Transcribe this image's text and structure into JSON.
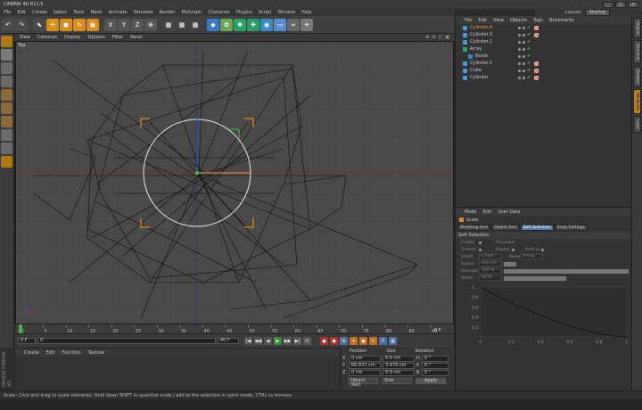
{
  "window": {
    "title": "CINEMA 4D R11.5",
    "min": "_",
    "max": "□",
    "close": "×"
  },
  "menubar": [
    "File",
    "Edit",
    "Create",
    "Select",
    "Tools",
    "Mesh",
    "Animate",
    "Simulate",
    "Render",
    "MoGraph",
    "Character",
    "Plugins",
    "Script",
    "Window",
    "Help"
  ],
  "layout": {
    "label": "Layout:",
    "value": "Startup"
  },
  "toolbar": {
    "items": [
      {
        "name": "undo-icon",
        "glyph": "↶",
        "color": "#4a4a4a"
      },
      {
        "name": "redo-icon",
        "glyph": "↷",
        "color": "#4a4a4a"
      },
      {
        "name": "sep"
      },
      {
        "name": "live-select-icon",
        "glyph": "⬉",
        "color": "#4a4a4a"
      },
      {
        "name": "move-icon",
        "glyph": "✛",
        "color": "#d98c1a"
      },
      {
        "name": "scale-icon",
        "glyph": "◼",
        "color": "#d98c1a"
      },
      {
        "name": "rotate-icon",
        "glyph": "↻",
        "color": "#d98c1a"
      },
      {
        "name": "recent-tool-icon",
        "glyph": "▣",
        "color": "#d98c1a"
      },
      {
        "name": "sep"
      },
      {
        "name": "x-axis-icon",
        "glyph": "X",
        "color": "#555"
      },
      {
        "name": "y-axis-icon",
        "glyph": "Y",
        "color": "#555"
      },
      {
        "name": "z-axis-icon",
        "glyph": "Z",
        "color": "#555"
      },
      {
        "name": "coord-system-icon",
        "glyph": "⊕",
        "color": "#555"
      },
      {
        "name": "sep"
      },
      {
        "name": "render-view-icon",
        "glyph": "▦",
        "color": "#444"
      },
      {
        "name": "render-picture-viewer-icon",
        "glyph": "▦",
        "color": "#444"
      },
      {
        "name": "render-settings-icon",
        "glyph": "▦",
        "color": "#444"
      },
      {
        "name": "sep"
      },
      {
        "name": "cube-icon",
        "glyph": "◆",
        "color": "#3a7ac4"
      },
      {
        "name": "subdivision-icon",
        "glyph": "✿",
        "color": "#6aa84f"
      },
      {
        "name": "array-icon",
        "glyph": "✺",
        "color": "#2ea06a"
      },
      {
        "name": "spline-icon",
        "glyph": "✚",
        "color": "#2a9a6a"
      },
      {
        "name": "deformer-icon",
        "glyph": "◉",
        "color": "#3c8ac6"
      },
      {
        "name": "scene-icon",
        "glyph": "▭",
        "color": "#5a8ad0"
      },
      {
        "name": "camera-icon",
        "glyph": "∞",
        "color": "#666"
      },
      {
        "name": "light-icon",
        "glyph": "☀",
        "color": "#777"
      }
    ]
  },
  "left_tools": [
    {
      "name": "make-editable-icon",
      "color": "#b07a10"
    },
    {
      "name": "model-mode-icon",
      "color": "#7a7a7a"
    },
    {
      "name": "texture-mode-icon",
      "color": "#6a6a6a"
    },
    {
      "name": "workplane-icon",
      "color": "#6a6a6a"
    },
    {
      "name": "points-mode-icon",
      "color": "#8a6a3a"
    },
    {
      "name": "edges-mode-icon",
      "color": "#8a6a3a"
    },
    {
      "name": "polygons-mode-icon",
      "color": "#8a6a3a"
    },
    {
      "name": "axis-mode-icon",
      "color": "#6a6a6a"
    },
    {
      "name": "tweak-mode-icon",
      "color": "#6a6a6a"
    },
    {
      "name": "snap-icon",
      "color": "#b07a10"
    }
  ],
  "viewport": {
    "menu": [
      "View",
      "Cameras",
      "Display",
      "Options",
      "Filter",
      "Panel"
    ],
    "label": "Top",
    "icons": [
      "✥",
      "⊕",
      "◱",
      "▣"
    ]
  },
  "timeline": {
    "ticks": [
      "0",
      "5",
      "10",
      "15",
      "20",
      "25",
      "30",
      "35",
      "40",
      "45",
      "50",
      "55",
      "60",
      "65",
      "70",
      "75",
      "80",
      "85",
      "90"
    ],
    "end_frame": "0 F",
    "start_field": "0 F",
    "current_field": "0",
    "end_field": "90 F",
    "play_buttons": [
      "|◀",
      "◀◀",
      "◀",
      "▶",
      "▶▶",
      "▶|",
      "⟳"
    ]
  },
  "material": {
    "menu": [
      "Create",
      "Edit",
      "Function",
      "Texture"
    ],
    "brand": "MAXON CINEMA 4D"
  },
  "coords": {
    "headers": [
      "Position",
      "Size",
      "Rotation"
    ],
    "rows": [
      {
        "axis": "X",
        "pos": "0 cm",
        "size": "6.6 cm",
        "rot_label": "H",
        "rot": "0 °"
      },
      {
        "axis": "Y",
        "pos": "66.831 cm",
        "size": "3.479 cm",
        "rot_label": "P",
        "rot": "0 °"
      },
      {
        "axis": "Z",
        "pos": "0 cm",
        "size": "6.9 cm",
        "rot_label": "B",
        "rot": "0 °"
      }
    ],
    "mode_select": "Object (Rel)",
    "size_select": "Size",
    "apply": "Apply"
  },
  "status": "Scale: Click and drag to scale elements. Hold down SHIFT to quantize scale / add to the selection in point mode, CTRL to remove.",
  "objects": {
    "menu": [
      "File",
      "Edit",
      "View",
      "Objects",
      "Tags",
      "Bookmarks"
    ],
    "rows": [
      {
        "name": "Cylinder.4",
        "indent": 0,
        "color": "#4a9ad0",
        "selected": true,
        "tag": true
      },
      {
        "name": "Cylinder.3",
        "indent": 0,
        "color": "#4a9ad0",
        "selected": false,
        "tag": true
      },
      {
        "name": "Cylinder.2",
        "indent": 0,
        "color": "#4a9ad0",
        "selected": false,
        "tag": false
      },
      {
        "name": "Array",
        "indent": 0,
        "color": "#2ea06a",
        "selected": false,
        "tag": false
      },
      {
        "name": "Boole",
        "indent": 1,
        "color": "#2a8ad0",
        "selected": false,
        "tag": false
      },
      {
        "name": "Cylinder.1",
        "indent": 0,
        "color": "#4a9ad0",
        "selected": false,
        "tag": true
      },
      {
        "name": "Cube",
        "indent": 0,
        "color": "#4a9ad0",
        "selected": false,
        "tag": true
      },
      {
        "name": "Cylinder",
        "indent": 0,
        "color": "#4a9ad0",
        "selected": false,
        "tag": true
      }
    ]
  },
  "attributes": {
    "menu": [
      "Mode",
      "Edit",
      "User Data"
    ],
    "tool_name": "Scale",
    "tabs": [
      {
        "label": "Modeling Axis",
        "on": false
      },
      {
        "label": "Object Axis",
        "on": false
      },
      {
        "label": "Soft Selection",
        "on": true
      },
      {
        "label": "Snap Settings",
        "on": false
      }
    ],
    "section": "Soft Selection",
    "enable_label": "Enable",
    "preview_label": "Preview",
    "surface_label": "Surface",
    "rubber_label": "Rubber",
    "restrict_label": "Restrict",
    "falloff_label": "Falloff",
    "falloff_value": "Linear",
    "mode_label": "Mode",
    "mode_value": "Group",
    "radius_label": "Radius",
    "radius_value": "100 cm",
    "strength_label": "Strength",
    "strength_value": "100 %",
    "width_label": "Width",
    "width_value": "50 %",
    "graph_x_ticks": [
      "0",
      "0.2",
      "0.4",
      "0.6",
      "0.8",
      "1"
    ],
    "graph_y_ticks": [
      "1",
      "0.8",
      "0.6",
      "0.4",
      "0.2"
    ]
  },
  "side_tabs": [
    "Objects",
    "Structure",
    "Browser",
    "Attributes",
    "Layer"
  ]
}
